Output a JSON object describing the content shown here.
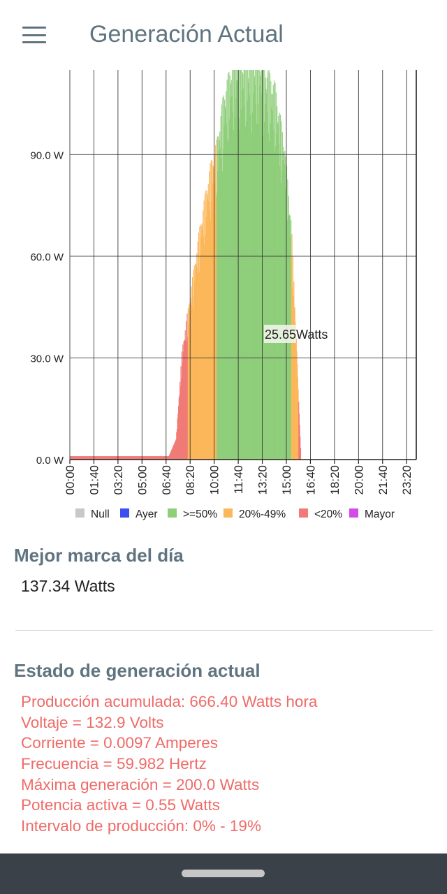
{
  "app_bar": {
    "title": "Generación Actual",
    "menu_icon": "hamburger-menu-icon"
  },
  "chart_data": {
    "type": "bar",
    "x_tick_labels": [
      "00:00",
      "01:40",
      "03:20",
      "05:00",
      "06:40",
      "08:20",
      "10:00",
      "11:40",
      "13:20",
      "15:00",
      "16:40",
      "18:20",
      "20:00",
      "21:40",
      "23:20"
    ],
    "y_tick_labels": [
      "0.0 W",
      "30.0 W",
      "60.0 W",
      "90.0 W"
    ],
    "ylim": [
      0,
      115
    ],
    "y_unit": "W",
    "grid": true,
    "legend_position": "bottom",
    "legend": [
      {
        "name": "Null",
        "color": "#c8c8c8"
      },
      {
        "name": "Ayer",
        "color": "#3d4ff0"
      },
      {
        "name": ">=50%",
        "color": "#8fce7a"
      },
      {
        "name": "20%-49%",
        "color": "#fbb75a"
      },
      {
        "name": "<20%",
        "color": "#f07a76"
      },
      {
        "name": "Mayor",
        "color": "#d44be8"
      }
    ],
    "highlight_label": "25.65Watts",
    "series_envelope": [
      {
        "time": "00:00",
        "watts": 1.0,
        "category": "<20%"
      },
      {
        "time": "06:50",
        "watts": 1.0,
        "category": "<20%"
      },
      {
        "time": "07:20",
        "watts": 6.0,
        "category": "<20%"
      },
      {
        "time": "07:45",
        "watts": 33.0,
        "category": "<20%"
      },
      {
        "time": "08:10",
        "watts": 45.0,
        "category": "20%-49%"
      },
      {
        "time": "09:00",
        "watts": 70.0,
        "category": "20%-49%"
      },
      {
        "time": "09:40",
        "watts": 87.0,
        "category": "20%-49%"
      },
      {
        "time": "10:10",
        "watts": 95.0,
        "category": ">=50%"
      },
      {
        "time": "10:40",
        "watts": 110.0,
        "category": ">=50%"
      },
      {
        "time": "11:20",
        "watts": 120.0,
        "category": ">=50%"
      },
      {
        "time": "13:10",
        "watts": 120.0,
        "category": ">=50%"
      },
      {
        "time": "14:10",
        "watts": 112.0,
        "category": ">=50%"
      },
      {
        "time": "14:50",
        "watts": 95.0,
        "category": ">=50%"
      },
      {
        "time": "15:20",
        "watts": 70.0,
        "category": "20%-49%"
      },
      {
        "time": "15:35",
        "watts": 45.0,
        "category": "20%-49%"
      },
      {
        "time": "15:50",
        "watts": 17.0,
        "category": "<20%"
      },
      {
        "time": "16:00",
        "watts": 0.0,
        "category": "<20%"
      }
    ]
  },
  "best_mark": {
    "title": "Mejor marca del día",
    "value": "137.34 Watts"
  },
  "status": {
    "title": "Estado de generación actual",
    "color": "#ef6b68",
    "lines": [
      "Producción acumulada: 666.40 Watts hora",
      "Voltaje = 132.9 Volts",
      "Corriente = 0.0097 Amperes",
      "Frecuencia = 59.982 Hertz",
      "Máxima generación = 200.0 Watts",
      "Potencia activa = 0.55 Watts",
      "Intervalo de producción: 0% - 19%"
    ]
  },
  "colors": {
    "accent": "#5f7480",
    "navbar": "#3a4148"
  }
}
